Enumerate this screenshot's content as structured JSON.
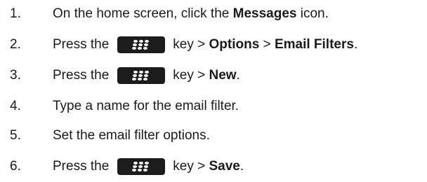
{
  "steps": [
    {
      "number": "1.",
      "before": "On the home screen, click the ",
      "bold1": "Messages",
      "after": " icon."
    },
    {
      "number": "2.",
      "before": "Press the",
      "key_icon": "blackberry-menu-key-icon",
      "after_key": "key > ",
      "bold1": "Options",
      "mid": " > ",
      "bold2": "Email Filters",
      "end": "."
    },
    {
      "number": "3.",
      "before": "Press the",
      "key_icon": "blackberry-menu-key-icon",
      "after_key": "key > ",
      "bold1": "New",
      "end": "."
    },
    {
      "number": "4.",
      "text": "Type a name for the email filter."
    },
    {
      "number": "5.",
      "text": "Set the email filter options."
    },
    {
      "number": "6.",
      "before": "Press the",
      "key_icon": "blackberry-menu-key-icon",
      "after_key": "key > ",
      "bold1": "Save",
      "end": "."
    }
  ],
  "colors": {
    "text": "#1a1a1a",
    "key_background": "#1c1c1c",
    "key_glyph": "#ffffff"
  }
}
